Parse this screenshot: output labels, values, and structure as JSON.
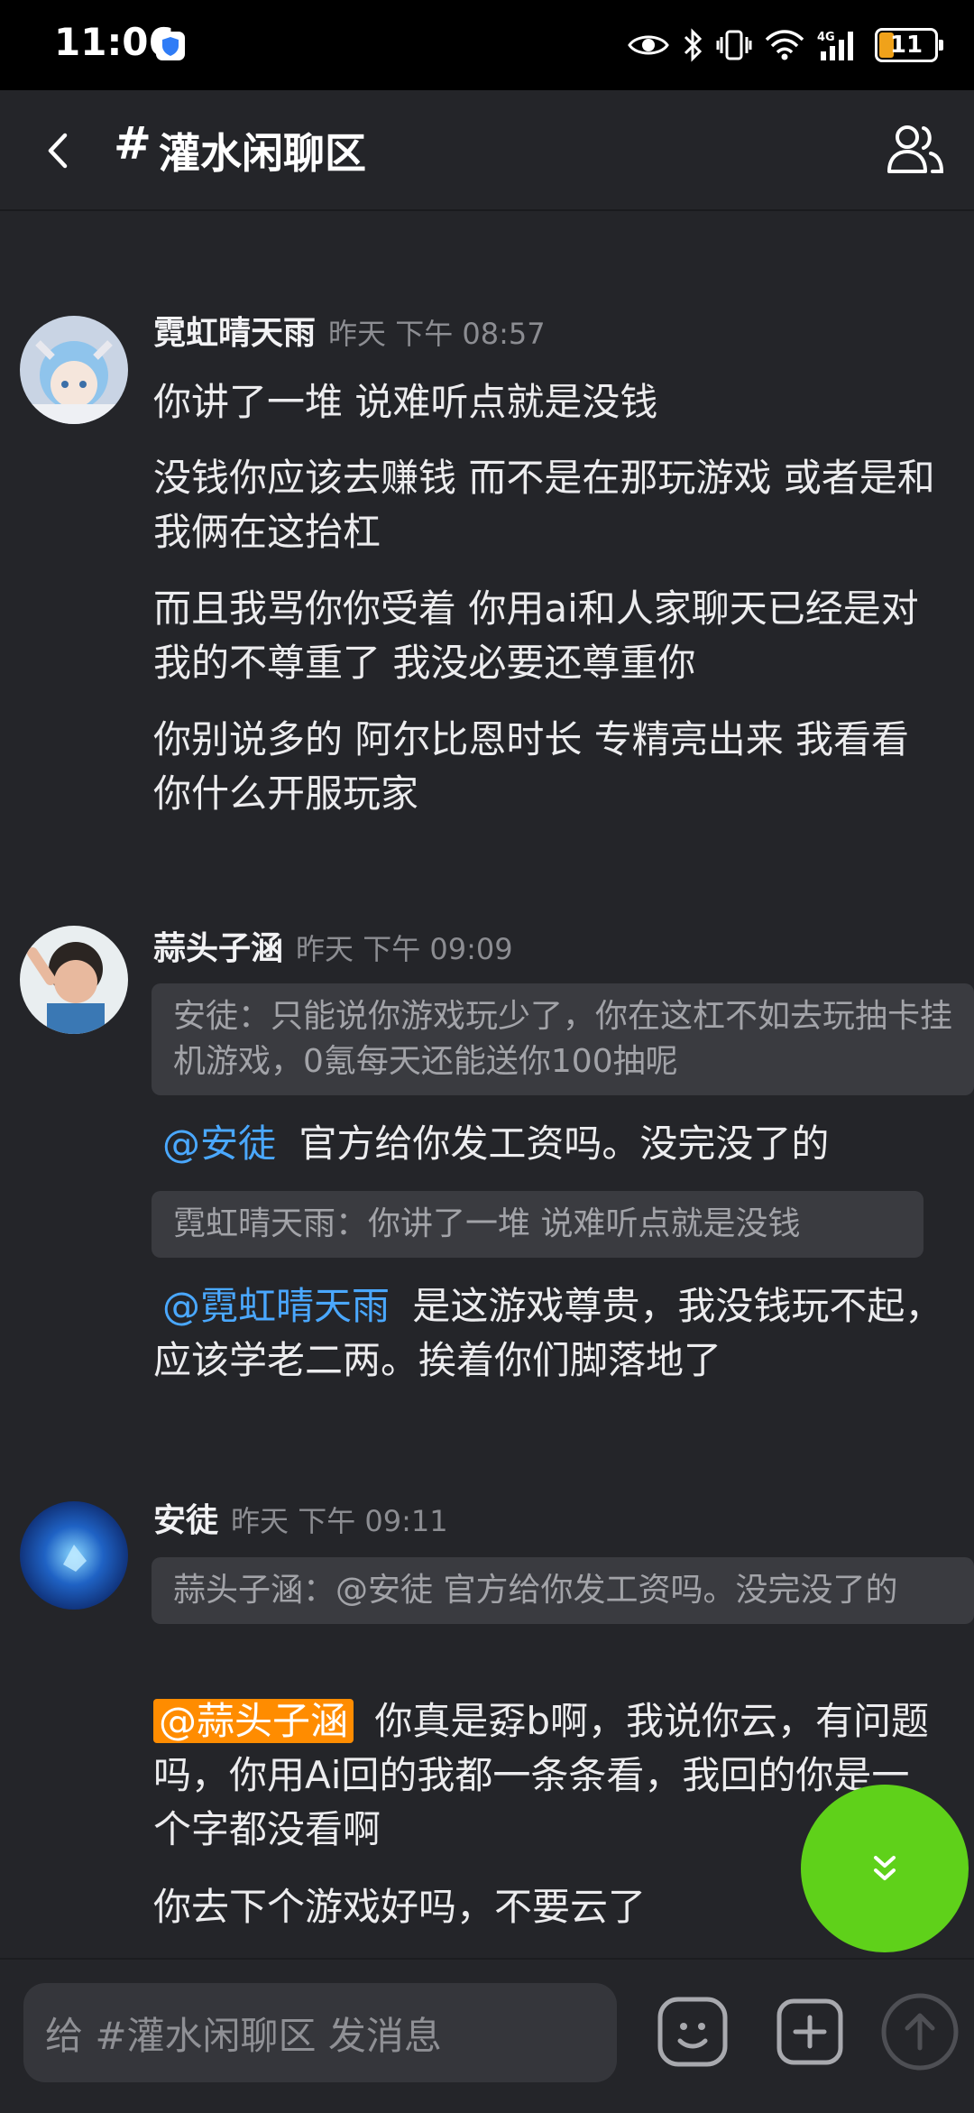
{
  "status": {
    "time": "11:06",
    "battery": "11"
  },
  "header": {
    "hash": "#",
    "title": "灌水闲聊区"
  },
  "messages": [
    {
      "author": "霓虹晴天雨",
      "time": "昨天 下午 08:57",
      "lines": [
        "你讲了一堆 说难听点就是没钱",
        "没钱你应该去赚钱 而不是在那玩游戏 或者是和我俩在这抬杠",
        "而且我骂你你受着 你用ai和人家聊天已经是对我的不尊重了 我没必要还尊重你",
        "你别说多的 阿尔比恩时长 专精亮出来 我看看你什么开服玩家"
      ]
    },
    {
      "author": "蒜头子涵",
      "time": "昨天 下午 09:09",
      "quote1": "安徒：只能说你游戏玩少了，你在这杠不如去玩抽卡挂机游戏，0氪每天还能送你100抽呢",
      "mention1": "@安徒",
      "text1": "官方给你发工资吗。没完没了的",
      "quote2": "霓虹晴天雨：你讲了一堆 说难听点就是没钱",
      "mention2": "@霓虹晴天雨",
      "text2": "是这游戏尊贵，我没钱玩不起，应该学老二两。挨着你们脚落地了"
    },
    {
      "author": "安徒",
      "time": "昨天 下午 09:11",
      "quote1": "蒜头子涵：@安徒 官方给你发工资吗。没完没了的",
      "mention1": "@蒜头子涵",
      "text1": "你真是孬b啊，我说你云，有问题吗，你用Ai回的我都一条条看，我回的你是一个字都没看啊",
      "text2": "你去下个游戏好吗，不要云了"
    }
  ],
  "composer": {
    "placeholder": "给 #灌水闲聊区 发消息"
  }
}
